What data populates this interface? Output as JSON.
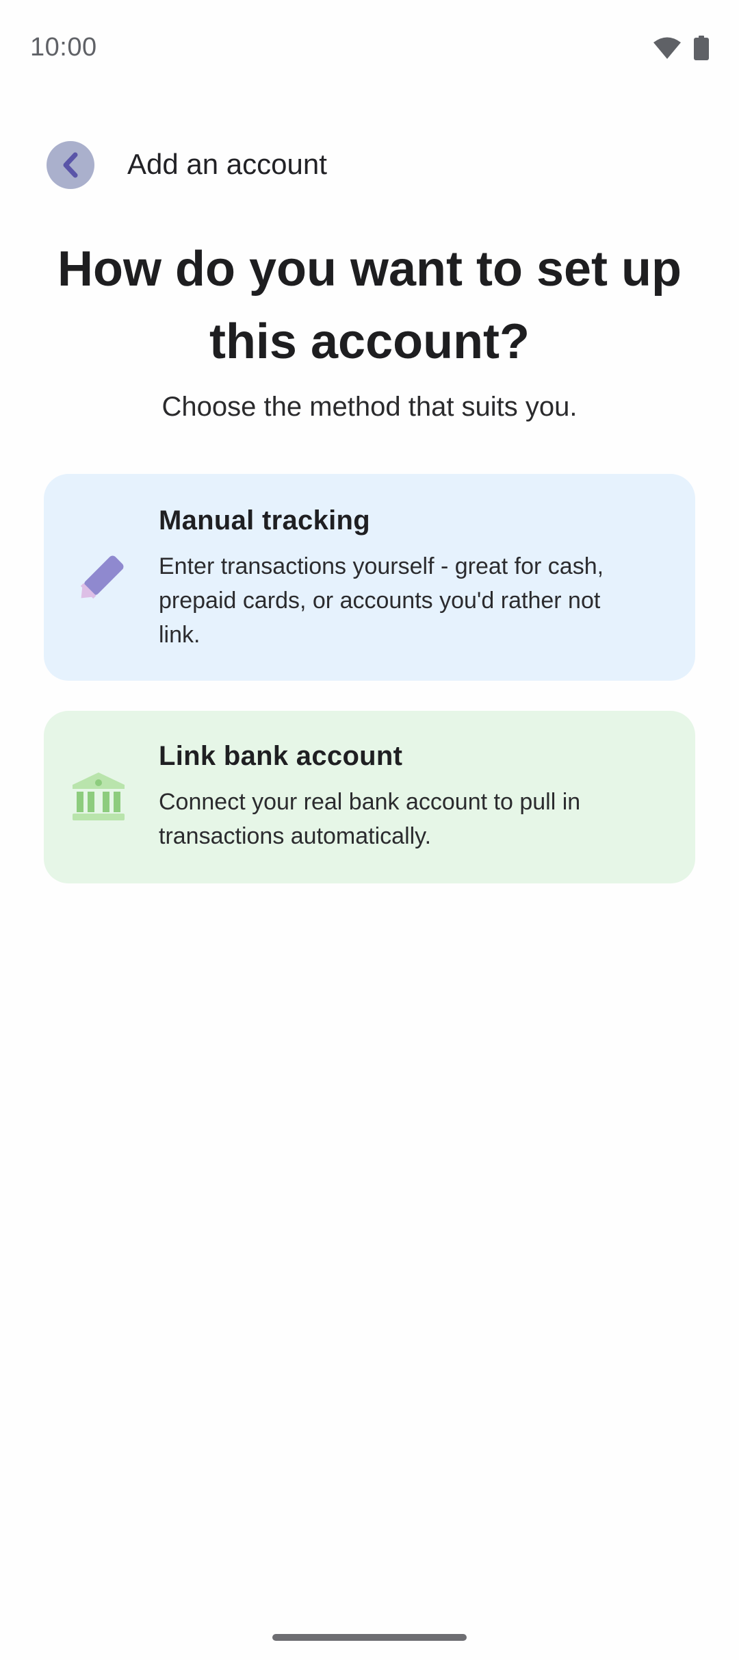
{
  "status_bar": {
    "time": "10:00",
    "icons": [
      "wifi-icon",
      "battery-icon"
    ]
  },
  "app_bar": {
    "back_icon": "chevron-left-icon",
    "title": "Add an account"
  },
  "header": {
    "headline": "How do you want to set up this account?",
    "subhead": "Choose the method that suits you."
  },
  "options": [
    {
      "icon": "pencil-icon",
      "title": "Manual tracking",
      "description": "Enter transactions yourself - great for cash, prepaid cards, or accounts you'd rather not link."
    },
    {
      "icon": "bank-icon",
      "title": "Link bank account",
      "description": "Connect your real bank account to pull in transactions automatically."
    }
  ],
  "colors": {
    "manual_card_bg": "#e6f2fd",
    "bank_card_bg": "#e6f6e7",
    "back_button_bg": "#aab0cc",
    "accent_purple": "#8f89cf",
    "accent_green": "#8dcc7e"
  }
}
